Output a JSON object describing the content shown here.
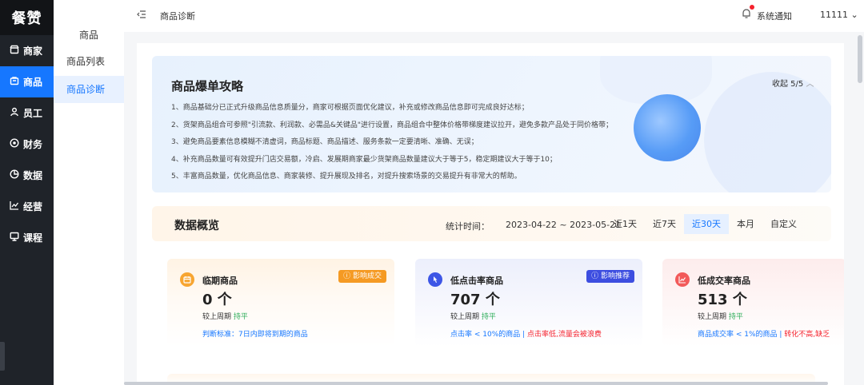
{
  "app": {
    "logo": "餐赞"
  },
  "sidebar": {
    "items": [
      {
        "label": "商家",
        "icon": "shop-icon"
      },
      {
        "label": "商品",
        "icon": "goods-icon",
        "active": true
      },
      {
        "label": "员工",
        "icon": "user-icon"
      },
      {
        "label": "财务",
        "icon": "finance-icon"
      },
      {
        "label": "数据",
        "icon": "pie-icon"
      },
      {
        "label": "经营",
        "icon": "trend-icon"
      },
      {
        "label": "课程",
        "icon": "course-icon"
      }
    ]
  },
  "subnav": {
    "title": "商品",
    "items": [
      {
        "label": "商品列表"
      },
      {
        "label": "商品诊断",
        "active": true
      }
    ]
  },
  "topbar": {
    "breadcrumb": "商品诊断",
    "notice": "系统通知",
    "user": "11111"
  },
  "banner": {
    "title": "商品爆单攻略",
    "collapse": "收起 5/5",
    "tips": [
      "1、商品基础分已正式升级商品信息质量分，商家可根据页面优化建议，补充或修改商品信息即可完成良好达标；",
      "2、货架商品组合可参照\"引流款、利润款、必需品&关键品\"进行设置，商品组合中整体价格带梯度建议拉开，避免多款产品处于同价格带；",
      "3、避免商品要素信息模糊不清虚词，商品标题、商品描述、服务条款一定要清晰、准确、无误；",
      "4、补充商品数量可有效提升门店交易额，冷启、发展期商家最少货架商品数量建议大于等于5，稳定期建议大于等于10；",
      "5、丰富商品数量，优化商品信息、商家装修、提升展现及排名，对提升搜索场景的交易提升有非常大的帮助。"
    ]
  },
  "overview": {
    "title": "数据概览",
    "range_label": "统计时间：",
    "range": "2023-04-22 ~ 2023-05-21",
    "tabs": [
      {
        "label": "近1天"
      },
      {
        "label": "近7天"
      },
      {
        "label": "近30天",
        "active": true
      },
      {
        "label": "本月"
      },
      {
        "label": "自定义"
      }
    ]
  },
  "cards": [
    {
      "name": "临期商品",
      "badge": "ⓘ 影响成交",
      "badge_color": "#f59a23",
      "icon_color": "#f7a531",
      "value": "0 个",
      "compare_label": "较上周期",
      "compare_value": "持平",
      "rule": "判断标准：7日内即将到期的商品",
      "rule_warn": ""
    },
    {
      "name": "低点击率商品",
      "badge": "ⓘ 影响推荐",
      "badge_color": "#3d4ee0",
      "icon_color": "#3d56e6",
      "value": "707 个",
      "compare_label": "较上周期",
      "compare_value": "持平",
      "rule": "点击率 < 10%的商品 | ",
      "rule_warn": "点击率低,流量会被浪费"
    },
    {
      "name": "低成交率商品",
      "badge": "",
      "badge_color": "",
      "icon_color": "#f25a5a",
      "value": "513 个",
      "compare_label": "较上周期",
      "compare_value": "持平",
      "rule": "商品成交率 < 1%的商品 | ",
      "rule_warn": "转化不高,缺乏"
    }
  ]
}
